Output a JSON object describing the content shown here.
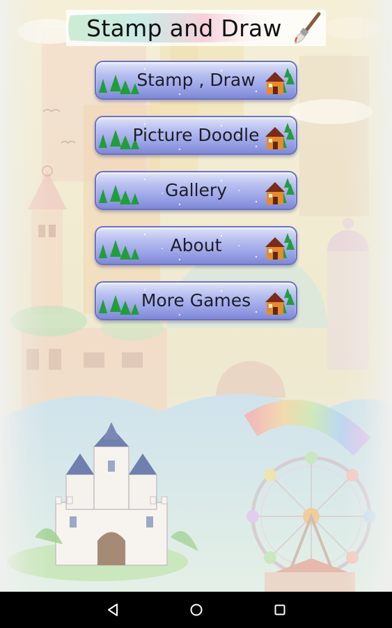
{
  "app": {
    "title": "Stamp and Draw"
  },
  "menu": {
    "items": [
      {
        "label": "Stamp , Draw"
      },
      {
        "label": "Picture Doodle"
      },
      {
        "label": "Gallery"
      },
      {
        "label": "About"
      },
      {
        "label": "More Games"
      }
    ]
  },
  "icons": {
    "title_icon": "paintbrush-icon",
    "left_decoration": "pine-trees-icon",
    "right_decoration": "house-icon"
  },
  "navbar": {
    "back": "back-icon",
    "home": "home-icon",
    "recents": "recents-icon"
  },
  "colors": {
    "button_top": "#dfe3f7",
    "button_bottom": "#7f88d6",
    "button_border": "#6a72c4",
    "navbar": "#000000"
  }
}
